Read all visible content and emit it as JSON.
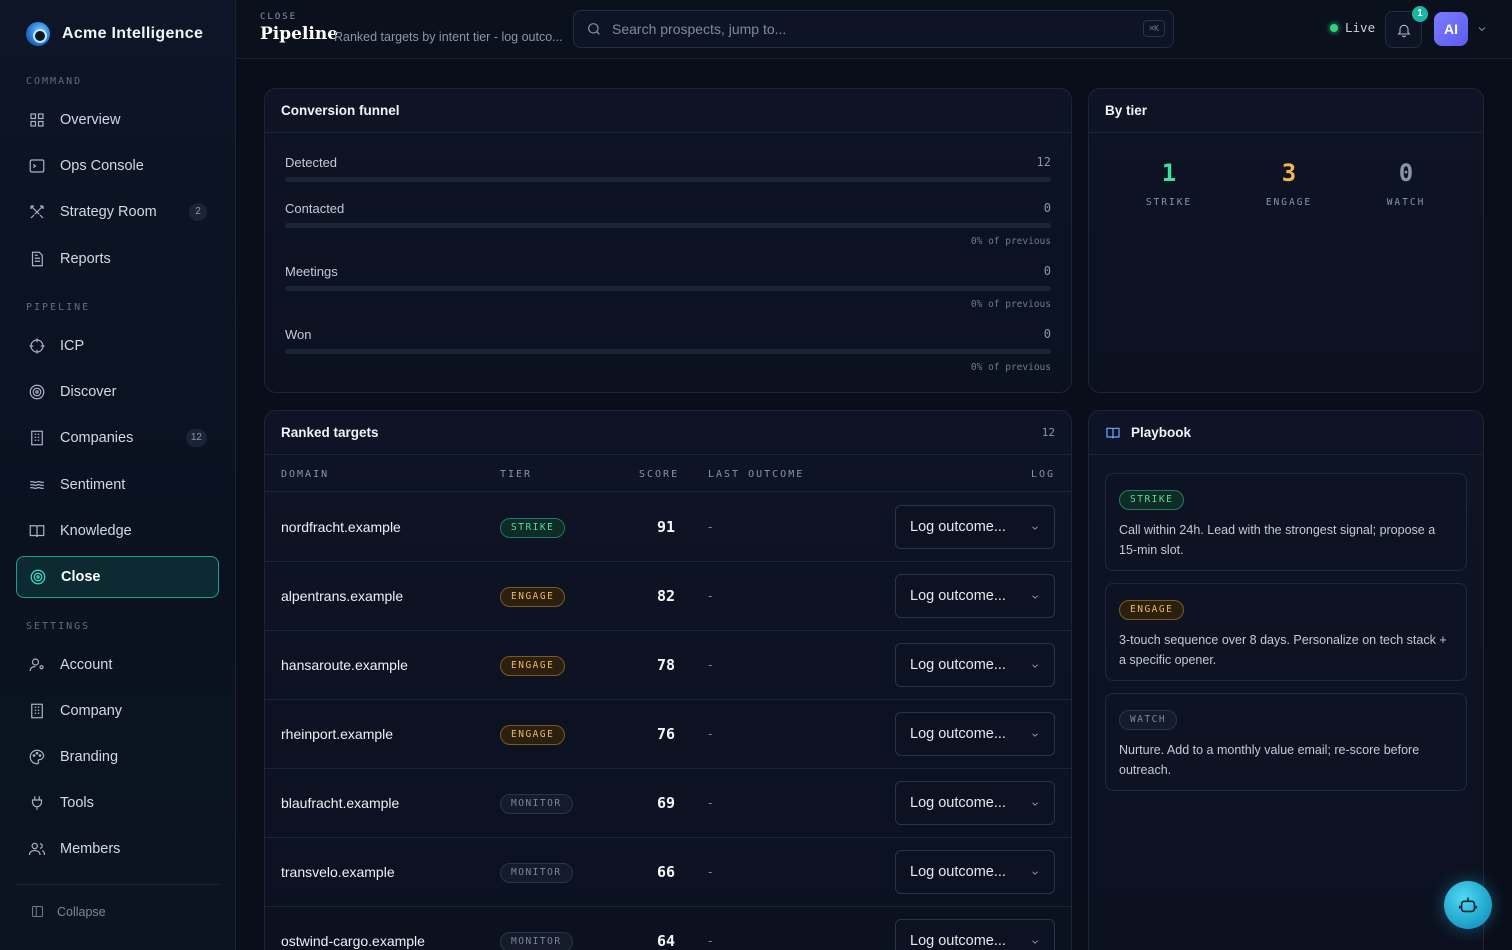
{
  "brand": {
    "name": "Acme Intelligence"
  },
  "sidebar": {
    "sections": {
      "command": "COMMAND",
      "pipeline": "PIPELINE",
      "settings": "SETTINGS"
    },
    "items": [
      {
        "label": "Overview",
        "icon": "grid-icon"
      },
      {
        "label": "Ops Console",
        "icon": "terminal-icon"
      },
      {
        "label": "Strategy Room",
        "icon": "swords-icon",
        "badge": "2"
      },
      {
        "label": "Reports",
        "icon": "document-icon"
      },
      {
        "label": "ICP",
        "icon": "crosshair-icon"
      },
      {
        "label": "Discover",
        "icon": "radar-icon"
      },
      {
        "label": "Companies",
        "icon": "building-icon",
        "badge": "12"
      },
      {
        "label": "Sentiment",
        "icon": "waves-icon"
      },
      {
        "label": "Knowledge",
        "icon": "book-icon"
      },
      {
        "label": "Close",
        "icon": "target-icon",
        "active": true
      },
      {
        "label": "Account",
        "icon": "user-gear-icon"
      },
      {
        "label": "Company",
        "icon": "building-icon"
      },
      {
        "label": "Branding",
        "icon": "palette-icon"
      },
      {
        "label": "Tools",
        "icon": "plug-icon"
      },
      {
        "label": "Members",
        "icon": "users-icon"
      }
    ],
    "collapse_label": "Collapse"
  },
  "header": {
    "crumb": "CLOSE",
    "title": "Pipeline",
    "subtitle": "Ranked targets by intent tier - log outco...",
    "search_placeholder": "Search prospects, jump to...",
    "search_shortcut": "⌘K",
    "live_label": "Live",
    "notifications_count": "1",
    "avatar_initials": "AI"
  },
  "funnel": {
    "title": "Conversion funnel",
    "stages": [
      {
        "label": "Detected",
        "count": "12",
        "fill": 0,
        "pct": ""
      },
      {
        "label": "Contacted",
        "count": "0",
        "fill": 0,
        "pct": "0% of previous"
      },
      {
        "label": "Meetings",
        "count": "0",
        "fill": 0,
        "pct": "0% of previous"
      },
      {
        "label": "Won",
        "count": "0",
        "fill": 0,
        "pct": "0% of previous"
      }
    ]
  },
  "by_tier": {
    "title": "By tier",
    "stats": [
      {
        "value": "1",
        "label": "STRIKE",
        "color": "#3fe0a0"
      },
      {
        "value": "3",
        "label": "ENGAGE",
        "color": "#f2b64e"
      },
      {
        "value": "0",
        "label": "WATCH",
        "color": "#8a94aa"
      }
    ]
  },
  "targets": {
    "title": "Ranked targets",
    "count": "12",
    "columns": [
      "DOMAIN",
      "TIER",
      "SCORE",
      "LAST OUTCOME",
      "LOG"
    ],
    "select_label": "Log outcome...",
    "rows": [
      {
        "domain": "nordfracht.example",
        "tier": "STRIKE",
        "score": "91",
        "last": "-"
      },
      {
        "domain": "alpentrans.example",
        "tier": "ENGAGE",
        "score": "82",
        "last": "-"
      },
      {
        "domain": "hansaroute.example",
        "tier": "ENGAGE",
        "score": "78",
        "last": "-"
      },
      {
        "domain": "rheinport.example",
        "tier": "ENGAGE",
        "score": "76",
        "last": "-"
      },
      {
        "domain": "blaufracht.example",
        "tier": "MONITOR",
        "score": "69",
        "last": "-"
      },
      {
        "domain": "transvelo.example",
        "tier": "MONITOR",
        "score": "66",
        "last": "-"
      },
      {
        "domain": "ostwind-cargo.example",
        "tier": "MONITOR",
        "score": "64",
        "last": "-"
      }
    ]
  },
  "playbook": {
    "title": "Playbook",
    "items": [
      {
        "tier": "STRIKE",
        "text": "Call within 24h. Lead with the strongest signal; propose a 15-min slot."
      },
      {
        "tier": "ENGAGE",
        "text": "3-touch sequence over 8 days. Personalize on tech stack + a specific opener."
      },
      {
        "tier": "WATCH",
        "text": "Nurture. Add to a monthly value email; re-score before outreach."
      }
    ]
  }
}
